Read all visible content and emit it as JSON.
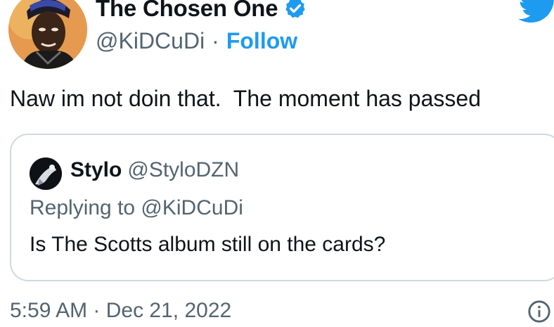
{
  "author": {
    "display_name": "The Chosen One",
    "handle": "@KiDCuDi",
    "separator": "·",
    "follow_label": "Follow"
  },
  "tweet": {
    "text": "Naw im not doin that.  The moment has passed"
  },
  "quoted_tweet": {
    "display_name": "Stylo",
    "handle": "@StyloDZN",
    "replying_to": "Replying to @KiDCuDi",
    "text": "Is The Scotts album still on the cards?"
  },
  "footer": {
    "timestamp": "5:59 AM · Dec 21, 2022"
  },
  "icons": {
    "verified": "verified-badge-icon",
    "brand": "twitter-bird-icon",
    "info": "info-icon"
  },
  "colors": {
    "accent": "#1d9bf0",
    "text": "#0f1419",
    "secondary_text": "#536471",
    "border": "#cfd9de"
  }
}
